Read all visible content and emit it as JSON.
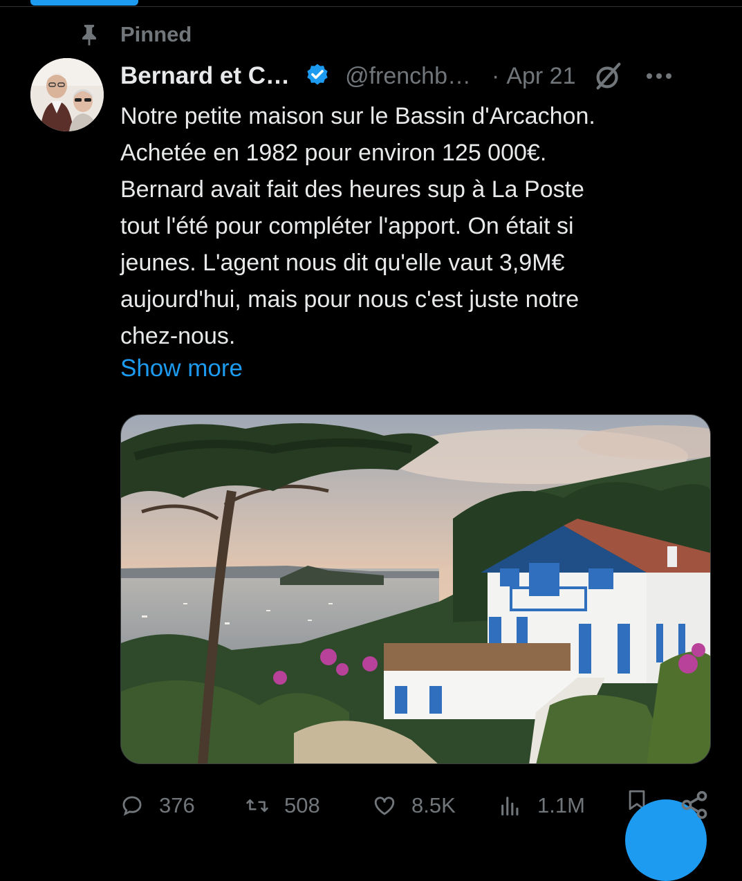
{
  "pinned": {
    "label": "Pinned"
  },
  "tweet": {
    "display_name": "Bernard et C…",
    "handle": "@frenchb…",
    "separator": "·",
    "date": "Apr 21",
    "text_lines": [
      "Notre petite maison sur le Bassin d'Arcachon.",
      "Achetée en 1982 pour environ 125 000€.",
      "Bernard avait fait des heures sup à La Poste",
      "tout l'été pour compléter l'apport. On était si",
      "jeunes. L'agent nous dit qu'elle vaut 3,9M€",
      "aujourd'hui, mais pour nous c'est juste notre",
      "chez-nous."
    ],
    "show_more": "Show more"
  },
  "actions": {
    "replies": "376",
    "retweets": "508",
    "likes": "8.5K",
    "views": "1.1M"
  },
  "icons": {
    "pin": "pin-icon",
    "verified": "verified-badge-icon",
    "grok": "grok-icon",
    "more": "more-icon",
    "reply": "reply-icon",
    "retweet": "retweet-icon",
    "like": "heart-icon",
    "views": "views-icon",
    "bookmark": "bookmark-icon",
    "share": "share-icon"
  },
  "colors": {
    "background": "#000000",
    "text": "#e7e9ea",
    "muted": "#71767b",
    "accent": "#1d9bf0"
  }
}
